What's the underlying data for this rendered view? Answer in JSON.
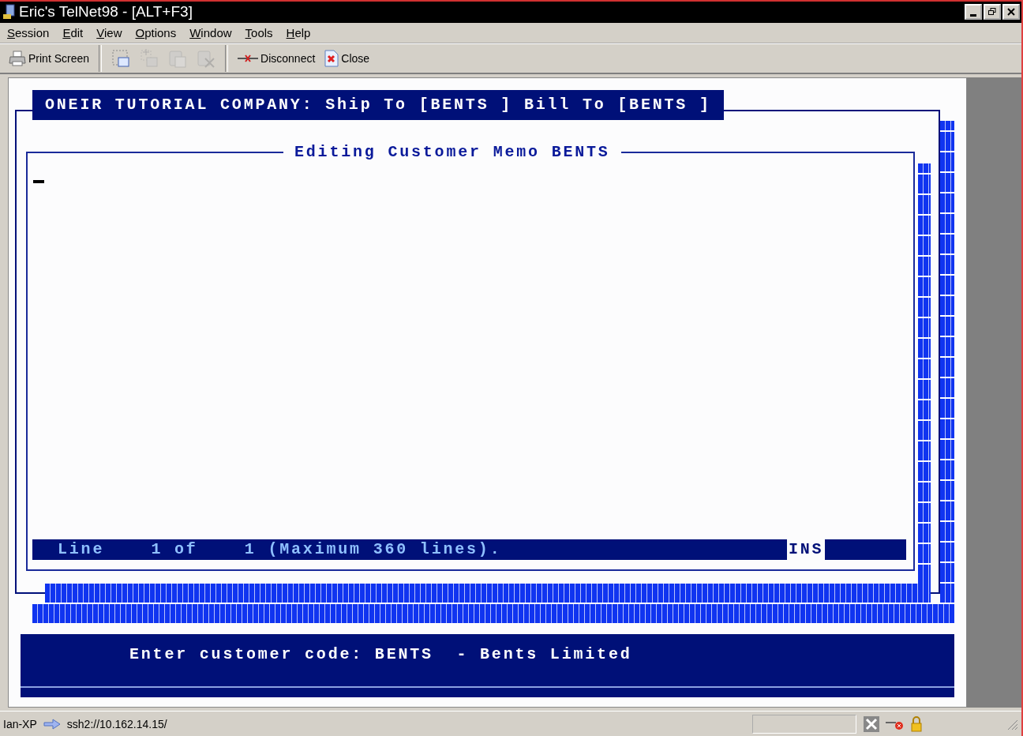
{
  "window": {
    "title": "Eric's TelNet98 - [ALT+F3]"
  },
  "menu": [
    {
      "label": "Session"
    },
    {
      "label": "Edit"
    },
    {
      "label": "View"
    },
    {
      "label": "Options"
    },
    {
      "label": "Window"
    },
    {
      "label": "Tools"
    },
    {
      "label": "Help"
    }
  ],
  "toolbar": [
    {
      "kind": "print",
      "label": "Print Screen",
      "disabled": false
    },
    {
      "kind": "separator"
    },
    {
      "kind": "select",
      "disabled": false
    },
    {
      "kind": "copy",
      "disabled": true
    },
    {
      "kind": "paste",
      "disabled": true
    },
    {
      "kind": "clear",
      "disabled": true
    },
    {
      "kind": "separator"
    },
    {
      "kind": "disconnect",
      "label": "Disconnect",
      "disabled": false
    },
    {
      "kind": "close",
      "label": "Close",
      "disabled": false
    }
  ],
  "terminal": {
    "header": "ONEIR TUTORIAL COMPANY: Ship To [BENTS ] Bill To [BENTS ]",
    "editor_title": "Editing Customer Memo BENTS",
    "status_line": "Line    1 of    1 (Maximum 360 lines).",
    "mode": "INS",
    "message": "Enter customer code: BENTS  - Bents Limited"
  },
  "status_bar": {
    "user": "Ian-XP",
    "address": "ssh2://10.162.14.15/"
  }
}
